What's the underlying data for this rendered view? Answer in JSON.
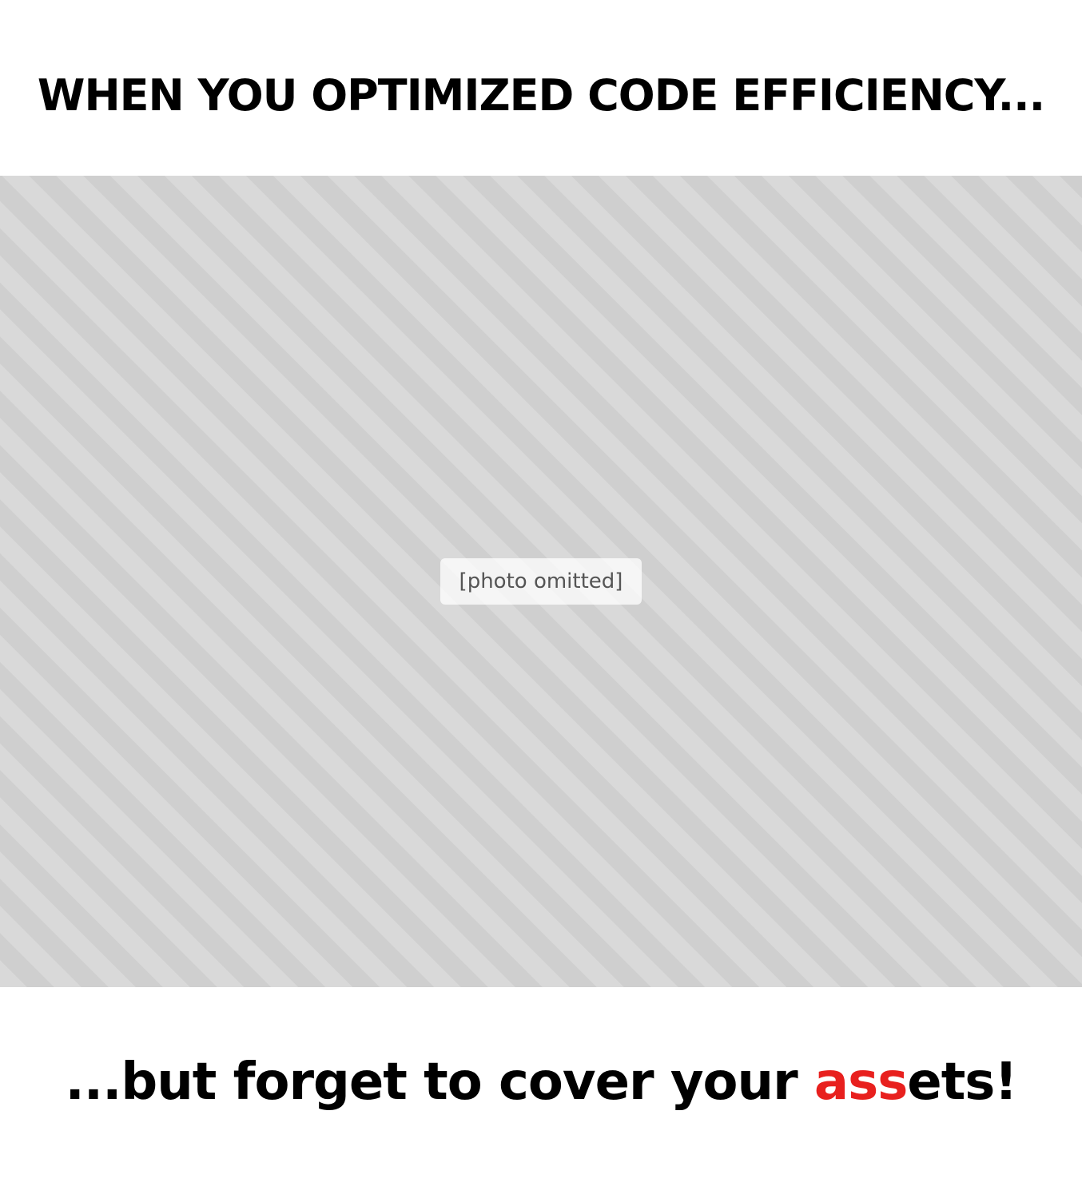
{
  "caption_top": "WHEN YOU OPTIMIZED CODE EFFICIENCY...",
  "caption_bottom": {
    "before": "...but forget to cover your ",
    "highlight": "ass",
    "after": "ets!"
  },
  "highlight_color": "#e8201e"
}
